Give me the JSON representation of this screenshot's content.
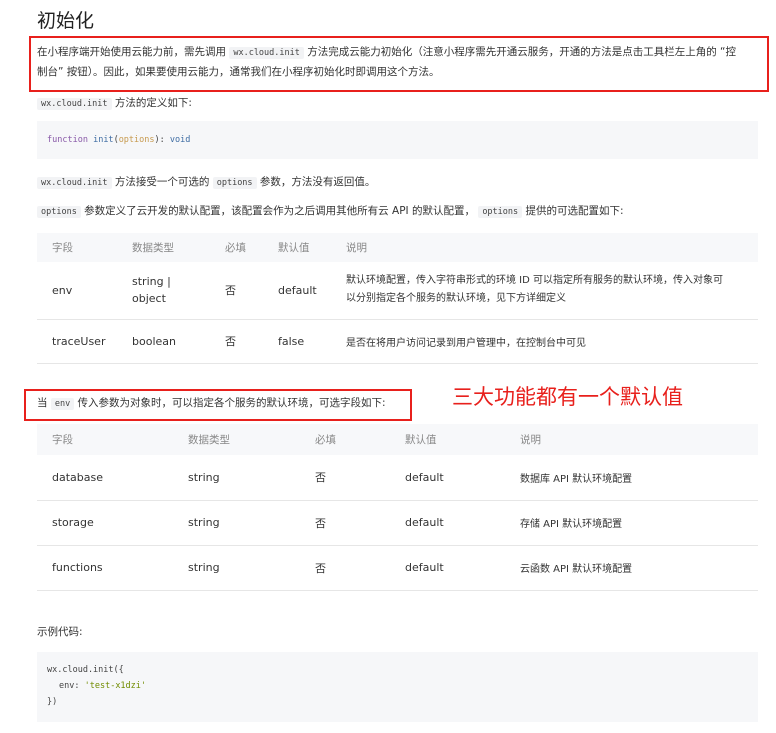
{
  "title": "初始化",
  "intro": {
    "a": "在小程序端开始使用云能力前，需先调用",
    "code": "wx.cloud.init",
    "b": "方法完成云能力初始化（注意小程序需先开通云服务，开通的方法是点击工具栏左上角的 “控",
    "c": "制台” 按钮）。因此，如果要使用云能力，通常我们在小程序初始化时即调用这个方法。"
  },
  "def_line": {
    "code": "wx.cloud.init",
    "text": "方法的定义如下:"
  },
  "signature": {
    "kw": "function",
    "fn": "init",
    "arg": "options",
    "ret": "void"
  },
  "accepts_line": {
    "code1": "wx.cloud.init",
    "text1": "方法接受一个可选的",
    "code2": "options",
    "text2": "参数，方法没有返回值。"
  },
  "options_line": {
    "code1": "options",
    "text1": "参数定义了云开发的默认配置，该配置会作为之后调用其他所有云 API 的默认配置，",
    "code2": "options",
    "text2": "提供的可选配置如下:"
  },
  "table1": {
    "headers": [
      "字段",
      "数据类型",
      "必填",
      "默认值",
      "说明"
    ],
    "rows": [
      {
        "field": "env",
        "type1": "string |",
        "type2": "object",
        "required": "否",
        "default": "default",
        "desc1": "默认环境配置，传入字符串形式的环境 ID 可以指定所有服务的默认环境，传入对象可",
        "desc2": "以分别指定各个服务的默认环境，见下方详细定义"
      },
      {
        "field": "traceUser",
        "type1": "boolean",
        "type2": "",
        "required": "否",
        "default": "false",
        "desc1": "是否在将用户访问记录到用户管理中，在控制台中可见",
        "desc2": ""
      }
    ]
  },
  "env_line": {
    "a": "当",
    "code": "env",
    "b": "传入参数为对象时，可以指定各个服务的默认环境，可选字段如下:"
  },
  "annotation": "三大功能都有一个默认值",
  "table2": {
    "headers": [
      "字段",
      "数据类型",
      "必填",
      "默认值",
      "说明"
    ],
    "rows": [
      {
        "field": "database",
        "type": "string",
        "required": "否",
        "default": "default",
        "desc": "数据库 API 默认环境配置"
      },
      {
        "field": "storage",
        "type": "string",
        "required": "否",
        "default": "default",
        "desc": "存储 API 默认环境配置"
      },
      {
        "field": "functions",
        "type": "string",
        "required": "否",
        "default": "default",
        "desc": "云函数 API 默认环境配置"
      }
    ]
  },
  "example_label": "示例代码:",
  "example": {
    "line1": "wx.cloud.init({",
    "key": "env",
    "val": "'test-x1dzi'",
    "line3": "})"
  }
}
